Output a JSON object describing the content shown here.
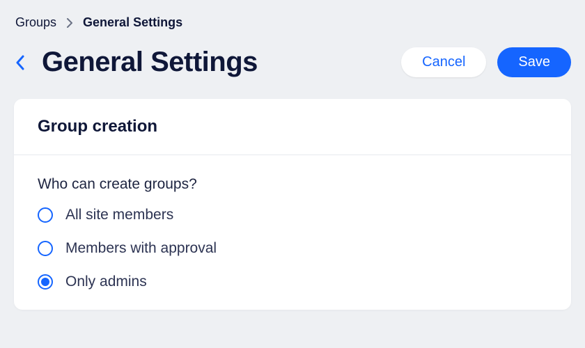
{
  "breadcrumb": {
    "root": "Groups",
    "current": "General Settings"
  },
  "header": {
    "title": "General Settings",
    "cancel_label": "Cancel",
    "save_label": "Save"
  },
  "card": {
    "title": "Group creation",
    "setting_label": "Who can create groups?",
    "options": [
      {
        "label": "All site members",
        "selected": false
      },
      {
        "label": "Members with approval",
        "selected": false
      },
      {
        "label": "Only admins",
        "selected": true
      }
    ]
  }
}
